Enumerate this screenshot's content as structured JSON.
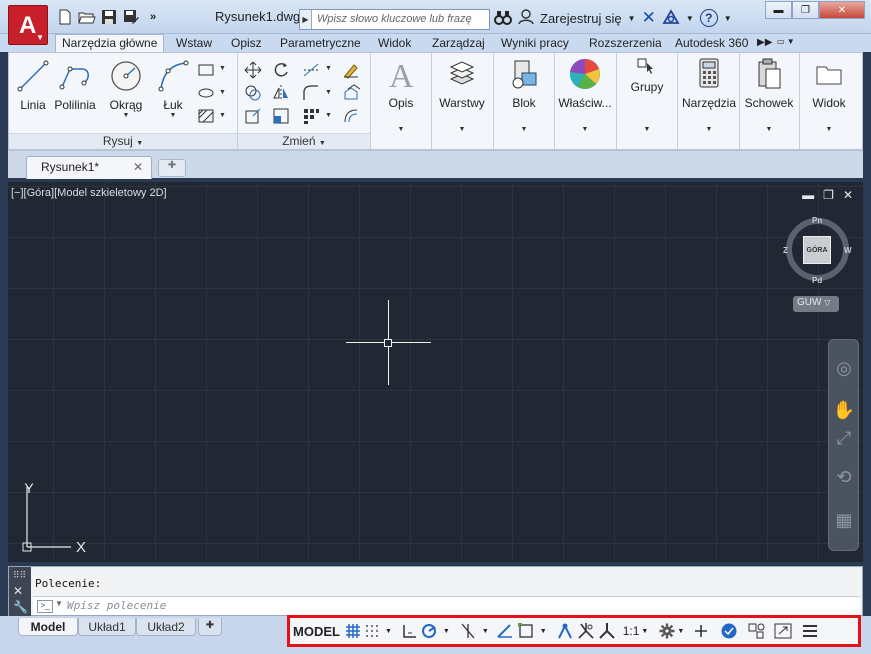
{
  "title_bar": {
    "document_title": "Rysunek1.dwg",
    "search_placeholder": "Wpisz słowo kluczowe lub frazę",
    "sign_in_label": "Zarejestruj się",
    "qat_icons": [
      "new-icon",
      "open-icon",
      "save-icon",
      "save-as-icon",
      "more-icon"
    ],
    "window_controls": [
      "minimize-icon",
      "restore-icon",
      "close-icon"
    ]
  },
  "ribbon_tabs": [
    {
      "label": "Narzędzia główne",
      "active": true
    },
    {
      "label": "Wstaw"
    },
    {
      "label": "Opisz"
    },
    {
      "label": "Parametryczne"
    },
    {
      "label": "Widok"
    },
    {
      "label": "Zarządzaj"
    },
    {
      "label": "Wyniki pracy"
    },
    {
      "label": "Rozszerzenia"
    },
    {
      "label": "Autodesk 360"
    }
  ],
  "ribbon": {
    "draw_panel": {
      "title": "Rysuj",
      "buttons": [
        {
          "label": "Linia",
          "icon": "line-icon"
        },
        {
          "label": "Polilinia",
          "icon": "polyline-icon"
        },
        {
          "label": "Okrąg",
          "icon": "circle-icon"
        },
        {
          "label": "Łuk",
          "icon": "arc-icon"
        }
      ]
    },
    "modify_panel": {
      "title": "Zmień"
    },
    "large_buttons": [
      {
        "label": "Opis",
        "icon": "annotation-icon"
      },
      {
        "label": "Warstwy",
        "icon": "layers-icon"
      },
      {
        "label": "Blok",
        "icon": "block-icon"
      },
      {
        "label": "Właściw...",
        "icon": "properties-icon"
      },
      {
        "label": "Grupy",
        "icon": "groups-icon"
      },
      {
        "label": "Narzędzia",
        "icon": "utilities-icon"
      },
      {
        "label": "Schowek",
        "icon": "clipboard-icon"
      },
      {
        "label": "Widok",
        "icon": "view-icon"
      }
    ]
  },
  "file_tabs": {
    "active": "Rysunek1*",
    "close_glyph": "✕"
  },
  "viewport": {
    "label": "[−][Góra][Model szkieletowy 2D]",
    "viewcube": {
      "face": "GÓRA",
      "north": "Pn",
      "south": "Pd",
      "east": "W",
      "west": "Z"
    },
    "ucs_label": "GUW",
    "axis_x": "X",
    "axis_y": "Y"
  },
  "command_line": {
    "history": "Polecenie:",
    "placeholder": "Wpisz polecenie"
  },
  "layout_tabs": [
    {
      "label": "Model",
      "active": true
    },
    {
      "label": "Układ1"
    },
    {
      "label": "Układ2"
    }
  ],
  "status_bar": {
    "model_label": "MODEL",
    "scale_label": "1:1",
    "highlight_color": "#e3111a"
  }
}
